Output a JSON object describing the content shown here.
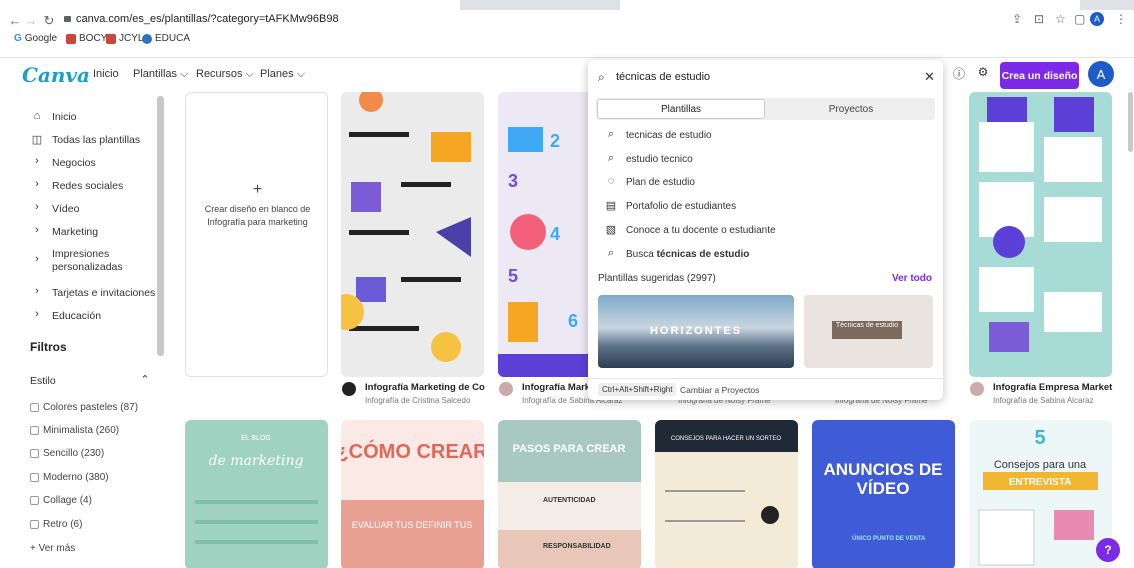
{
  "browser": {
    "url": "canva.com/es_es/plantillas/?category=tAFKMw96B98",
    "bookmarks": [
      "Google",
      "BOCYL",
      "JCYL",
      "EDUCA"
    ]
  },
  "app": {
    "logo": "Canva",
    "menu": [
      "Inicio",
      "Plantillas ⌵",
      "Recursos ⌵",
      "Planes ⌵"
    ],
    "create_button": "Crea un diseño",
    "avatar_letter": "A",
    "brand_color": "#7d2ae8"
  },
  "sidebar": {
    "items": [
      {
        "icon": "home-icon",
        "label": "Inicio"
      },
      {
        "icon": "grid-icon",
        "label": "Todas las plantillas"
      },
      {
        "icon": "chevron-right-icon",
        "label": "Negocios"
      },
      {
        "icon": "chevron-right-icon",
        "label": "Redes sociales"
      },
      {
        "icon": "chevron-right-icon",
        "label": "Vídeo"
      },
      {
        "icon": "chevron-right-icon",
        "label": "Marketing"
      },
      {
        "icon": "chevron-right-icon",
        "label": "Impresiones personalizadas"
      },
      {
        "icon": "chevron-right-icon",
        "label": "Tarjetas e invitaciones"
      },
      {
        "icon": "chevron-right-icon",
        "label": "Educación"
      }
    ],
    "filters_title": "Filtros",
    "style_title": "Estilo",
    "styles": [
      "Colores pasteles (87)",
      "Minimalista (260)",
      "Sencillo (230)",
      "Moderno (380)",
      "Collage (4)",
      "Retro (6)"
    ],
    "see_more": "+ Ver más"
  },
  "blank_card": {
    "plus": "+",
    "text": "Crear diseño en blanco de Infografía para marketing"
  },
  "cards_row1": [
    {
      "title": "Infografía Marketing de Con...",
      "author": "Infografía de Cristina Salcedo"
    },
    {
      "title": "Infografía Marke...",
      "author": "Infografía de Sabina Alcaraz"
    },
    {
      "title": "",
      "author": "Infografía de Noisy Frame"
    },
    {
      "title": "",
      "author": "Infografía de Noisy Frame"
    },
    {
      "title": "Infografía Empresa Marketi...",
      "author": "Infografía de Sabina Alcaraz"
    }
  ],
  "search": {
    "query": "técnicas de estudio",
    "tabs": [
      "Plantillas",
      "Proyectos"
    ],
    "suggestions": [
      {
        "icon": "search-icon",
        "text": "tecnicas de estudio"
      },
      {
        "icon": "search-icon",
        "text": "estudio tecnico"
      },
      {
        "icon": "apple-icon",
        "text": "Plan de estudio"
      },
      {
        "icon": "document-icon",
        "text": "Portafolio de estudiantes"
      },
      {
        "icon": "image-icon",
        "text": "Conoce a tu docente o estudiante"
      }
    ],
    "busca_prefix": "Busca ",
    "busca_term": "técnicas de estudio",
    "suggested_label": "Plantillas sugeridas (2997)",
    "see_all": "Ver todo",
    "thumb1_text": "HORIZONTES",
    "thumb2_text": "Técnicas de estudio",
    "shortcut": "Ctrl+Alt+Shift+Right",
    "shortcut_label": "Cambiar a Proyectos"
  },
  "help_button": "?"
}
